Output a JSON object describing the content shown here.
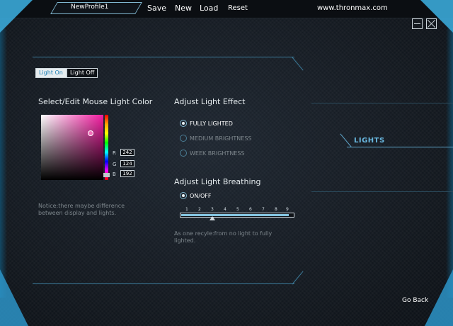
{
  "topbar": {
    "profile_name": "NewProfile1",
    "menu": [
      "Save",
      "New",
      "Load",
      "Reset"
    ],
    "website": "www.thronmax.com"
  },
  "tabs": {
    "light_on": "Light On",
    "light_off": "Light Off"
  },
  "color_section": {
    "title": "Select/Edit Mouse Light Color",
    "r_label": "R",
    "g_label": "G",
    "b_label": "B",
    "r": "242",
    "g": "124",
    "b": "192",
    "notice_line1": "Notice:there maybe difference",
    "notice_line2": "between display and lights."
  },
  "effect_section": {
    "title": "Adjust Light Effect",
    "options": [
      "FULLY LIGHTED",
      "MEDIUM BRIGHTNESS",
      "WEEK BRIGHTNESS"
    ],
    "selected_index": 0
  },
  "breathing_section": {
    "title": "Adjust Light Breathing",
    "toggle_label": "ON/OFF",
    "toggle_on": true,
    "slider_ticks": [
      "1",
      "2",
      "3",
      "4",
      "5",
      "6",
      "7",
      "8",
      "9"
    ],
    "slider_value": 3,
    "note_line1": "As one recyle:from no light to fully",
    "note_line2": "lighted."
  },
  "side_panel": {
    "active_label": "LIGHTS"
  },
  "footer": {
    "go_back": "Go Back"
  },
  "colors": {
    "accent": "#69b8e0",
    "selected_color": "#f27cc0"
  }
}
